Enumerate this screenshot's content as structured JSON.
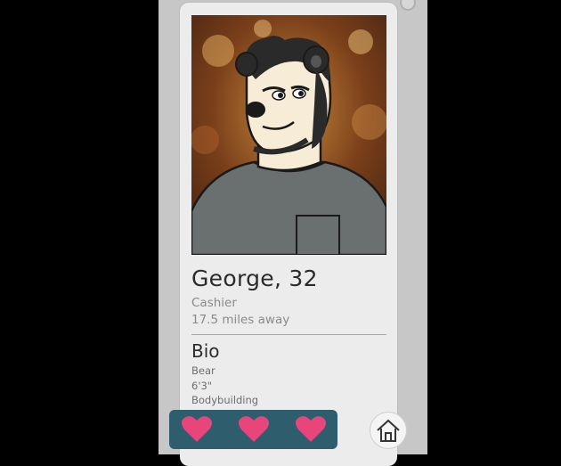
{
  "profile": {
    "name_age": "George, 32",
    "job": "Cashier",
    "distance": "17.5 miles away"
  },
  "bio": {
    "title": "Bio",
    "lines": [
      "Bear",
      "6'3\"",
      "Bodybuilding"
    ]
  },
  "actions": {
    "buttons": [
      {
        "icon": "heart-icon"
      },
      {
        "icon": "heart-icon"
      },
      {
        "icon": "heart-icon"
      }
    ],
    "home_icon": "home-icon"
  },
  "colors": {
    "heart": "#e8457a",
    "action_bar": "#2e5e6e",
    "card": "#ececec",
    "panel": "#c7c7c7"
  }
}
